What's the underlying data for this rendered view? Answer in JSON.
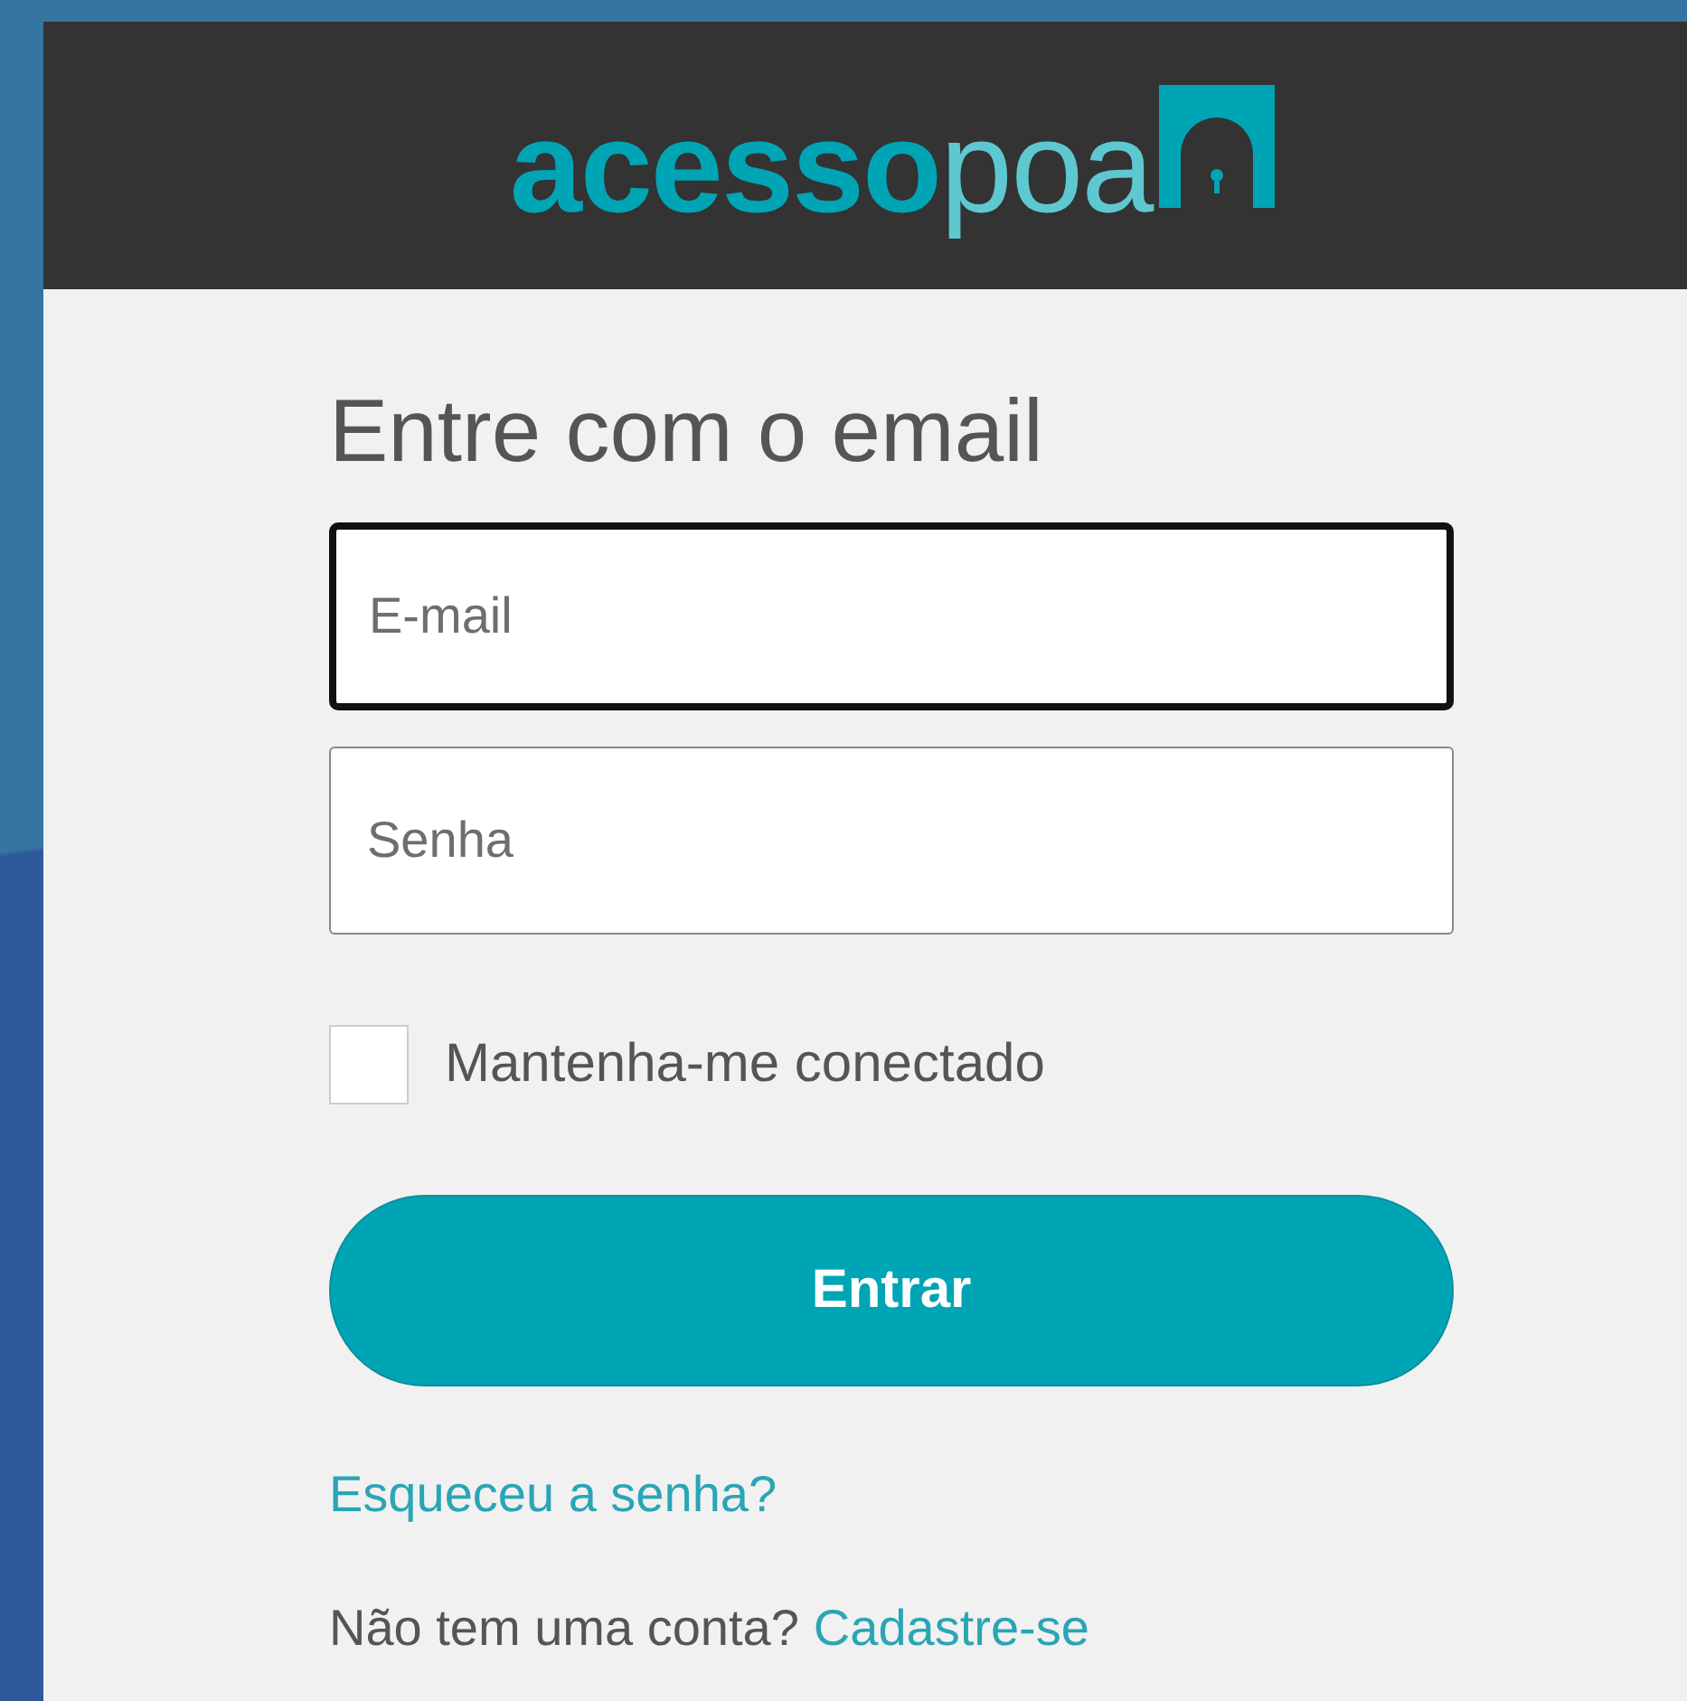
{
  "header": {
    "logo": {
      "bold_part": "acesso",
      "light_part": "poa"
    }
  },
  "form": {
    "title": "Entre com o email",
    "fields": [
      {
        "placeholder": "E-mail",
        "focused": true
      },
      {
        "placeholder": "Senha",
        "focused": false
      }
    ],
    "remember": {
      "label": "Mantenha-me conectado",
      "checked": false
    },
    "submit": "Entrar",
    "forgot_link": "Esqueceu a senha?",
    "signup": {
      "prompt": "Não tem uma conta?",
      "link": "Cadastre-se"
    }
  }
}
